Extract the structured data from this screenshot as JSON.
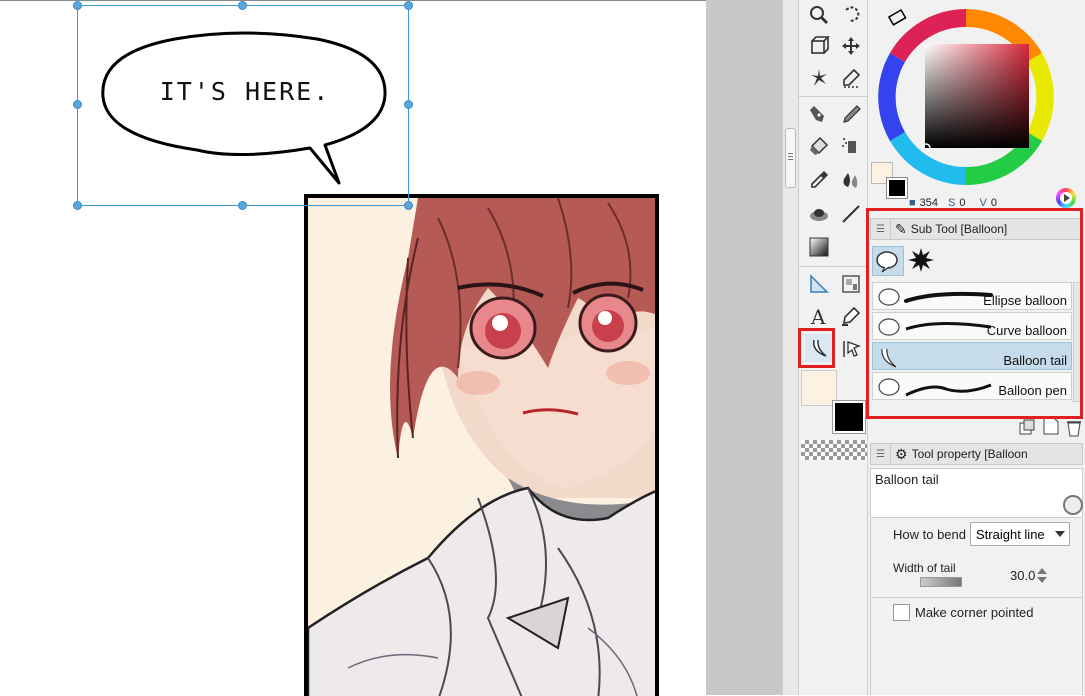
{
  "canvas": {
    "balloon_text": "IT'S HERE."
  },
  "color": {
    "h_value": "354",
    "s_value": "0",
    "v_value": "0",
    "main_color": "#000000",
    "sub_color": "#fdf1e2",
    "hue_square_color": "#d8283a"
  },
  "subtool": {
    "header": "Sub Tool [Balloon]",
    "items": [
      {
        "label": "Ellipse balloon"
      },
      {
        "label": "Curve balloon"
      },
      {
        "label": "Balloon tail"
      },
      {
        "label": "Balloon pen"
      }
    ],
    "selected_index": 2
  },
  "toolprop": {
    "header": "Tool property [Balloon",
    "tool_name": "Balloon tail",
    "how_to_bend_label": "How to bend",
    "how_to_bend_value": "Straight line",
    "width_label": "Width of tail",
    "width_value": "30.0",
    "corner_label": "Make corner pointed",
    "corner_checked": false
  }
}
